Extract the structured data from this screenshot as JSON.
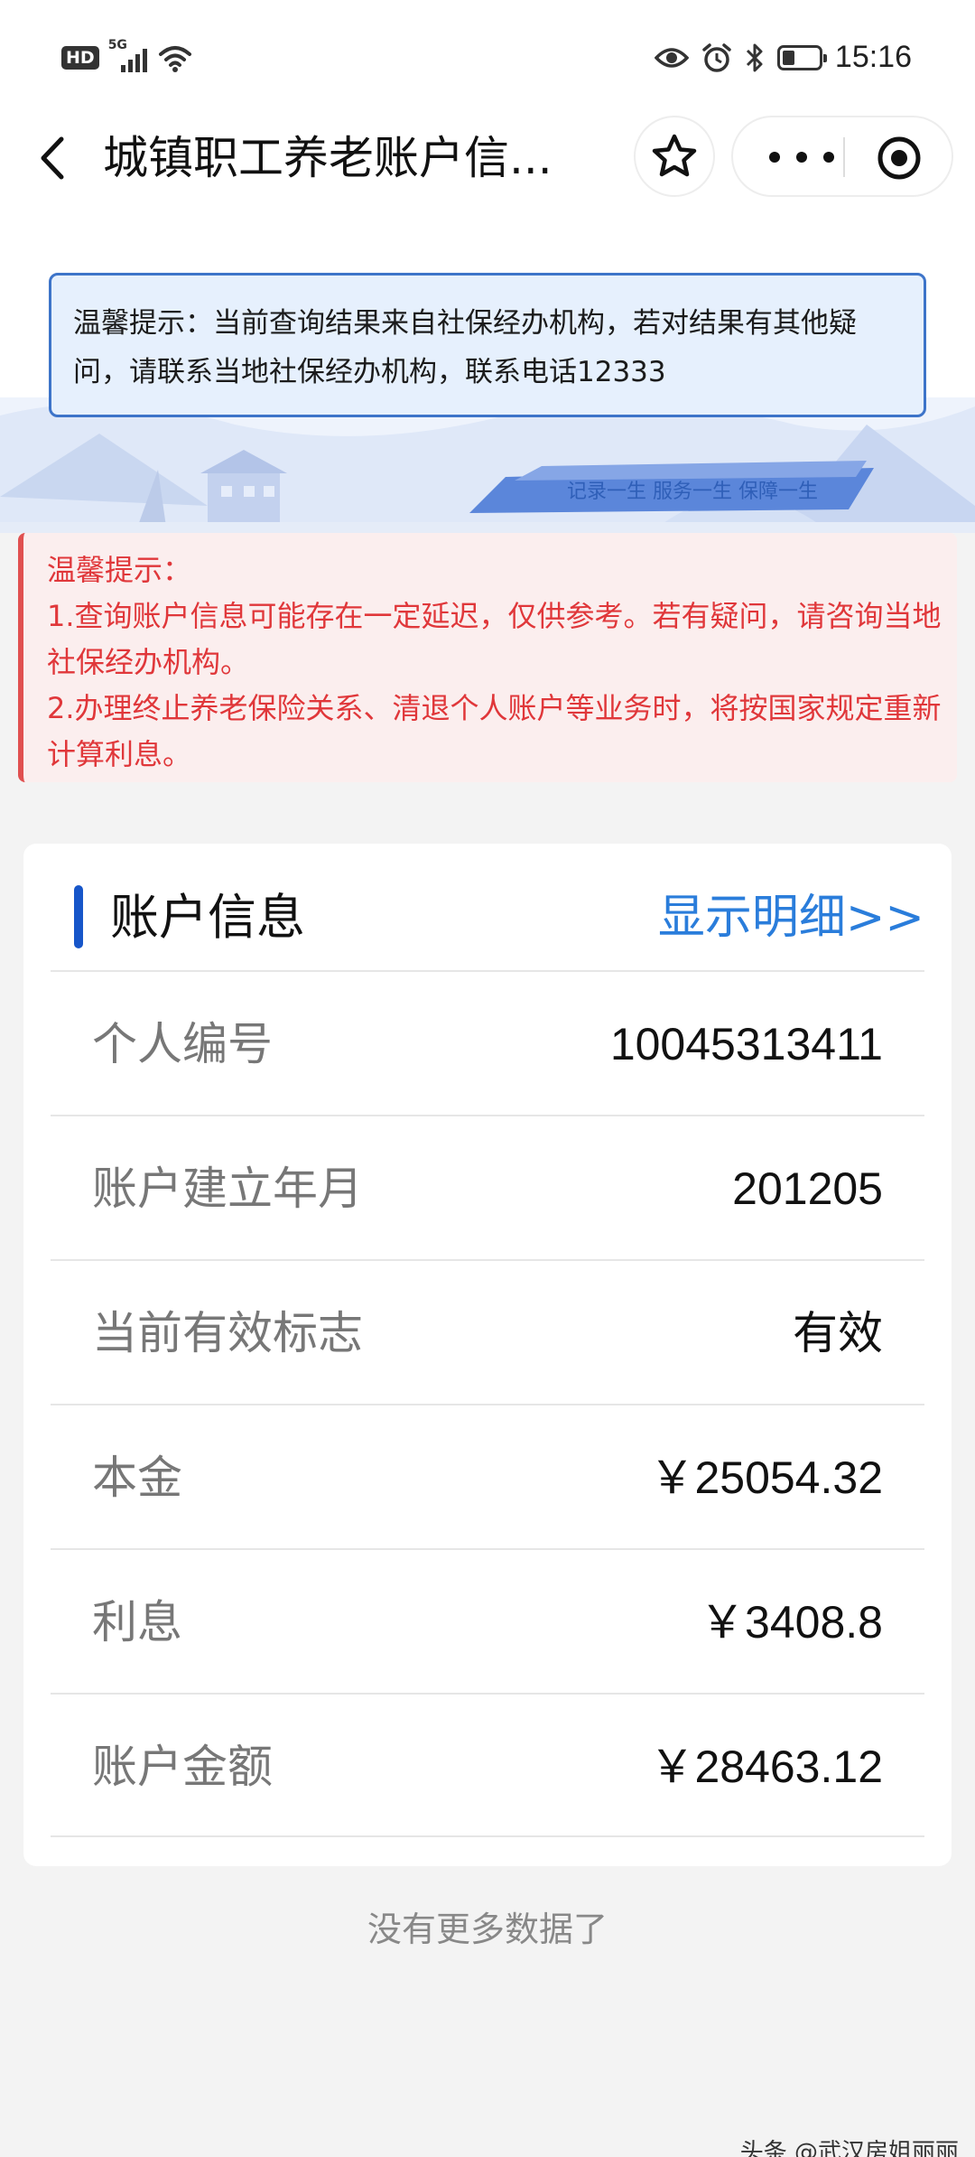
{
  "status_bar": {
    "hd": "HD",
    "network": "5G",
    "time": "15:16",
    "battery_level": 0.35,
    "icons": [
      "signal-icon",
      "wifi-icon",
      "eye-icon",
      "alarm-icon",
      "bluetooth-icon",
      "battery-icon"
    ]
  },
  "nav": {
    "title": "城镇职工养老账户信...",
    "icons": [
      "back-arrow-icon",
      "star-icon",
      "more-icon",
      "close-mini-program-icon"
    ]
  },
  "notice_blue": {
    "text": "温馨提示：当前查询结果来自社保经办机构，若对结果有其他疑问，请联系当地社保经办机构，联系电话12333"
  },
  "banner": {
    "slogan": "记录一生 服务一生 保障一生"
  },
  "notice_red": {
    "title": "温馨提示：",
    "line1": "1.查询账户信息可能存在一定延迟，仅供参考。若有疑问，请咨询当地社保经办机构。",
    "line2": "2.办理终止养老保险关系、清退个人账户等业务时，将按国家规定重新计算利息。"
  },
  "card": {
    "title": "账户信息",
    "detail_link": "显示明细>>",
    "rows": [
      {
        "label": "个人编号",
        "value": "10045313411"
      },
      {
        "label": "账户建立年月",
        "value": "201205"
      },
      {
        "label": "当前有效标志",
        "value": "有效"
      },
      {
        "label": "本金",
        "value": "￥25054.32"
      },
      {
        "label": "利息",
        "value": "￥3408.8"
      },
      {
        "label": "账户金额",
        "value": "￥28463.12"
      }
    ]
  },
  "footer": {
    "no_more": "没有更多数据了",
    "watermark": "头条 @武汉房姐丽丽"
  },
  "colors": {
    "accent_blue": "#1756c9",
    "link_blue": "#2a7ddb",
    "warning_red": "#e0373a",
    "notice_border": "#3d74c9"
  }
}
